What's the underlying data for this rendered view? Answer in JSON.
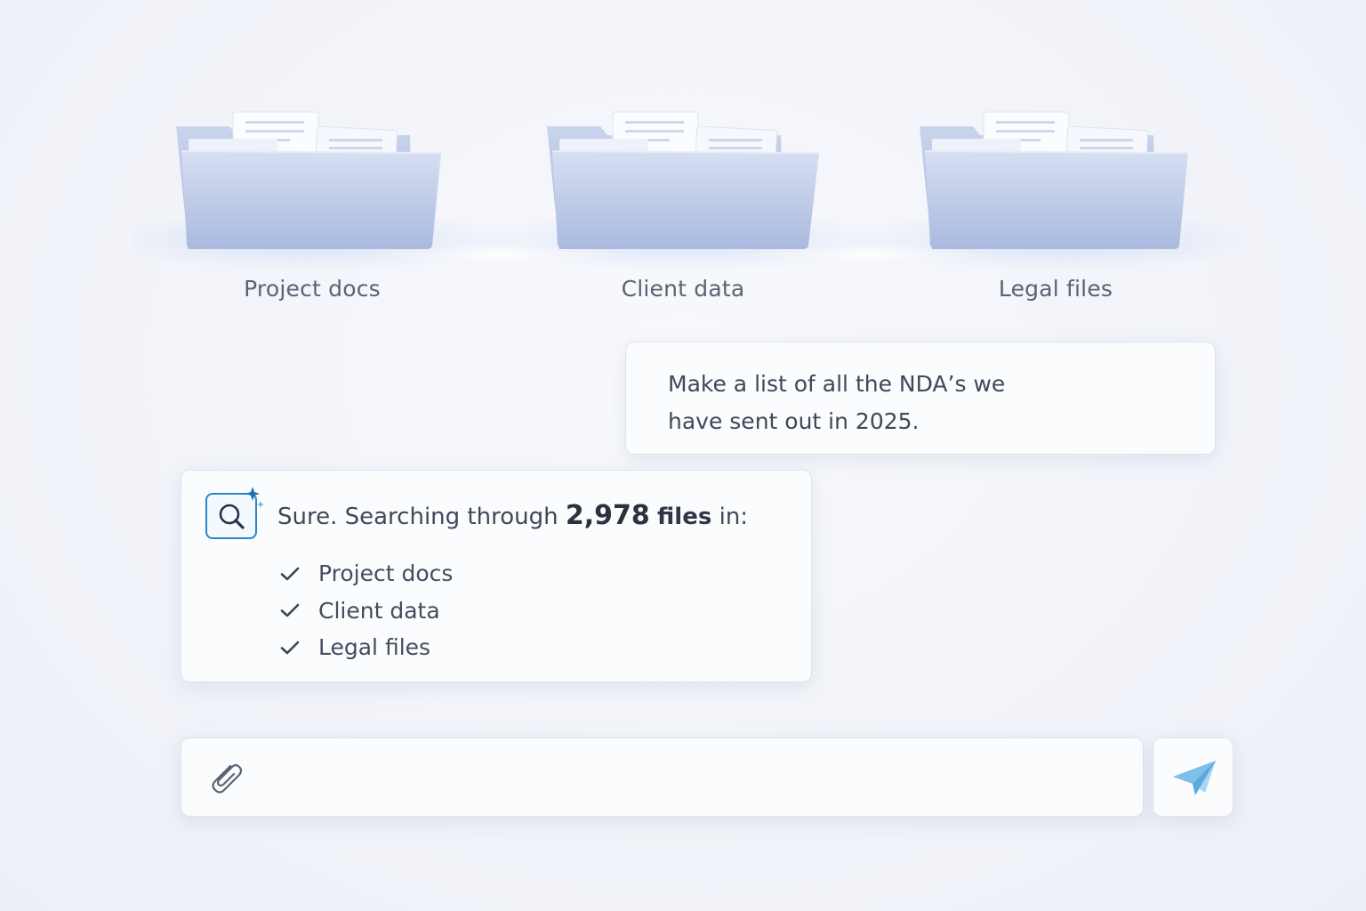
{
  "folders": [
    {
      "label": "Project docs",
      "icon": "folder-icon"
    },
    {
      "label": "Client data",
      "icon": "folder-icon"
    },
    {
      "label": "Legal files",
      "icon": "folder-icon"
    }
  ],
  "chat": {
    "user_message": "Make a list of all the NDA’s we have sent out in 2025.",
    "assistant": {
      "icon": "ai-search-icon",
      "prefix": "Sure. Searching through",
      "count": "2,978",
      "unit": "files",
      "suffix": "in:",
      "checked_sources": [
        "Project docs",
        "Client data",
        "Legal files"
      ]
    }
  },
  "composer": {
    "placeholder": "",
    "attach_icon": "paperclip-icon",
    "send_icon": "paper-plane-icon"
  },
  "colors": {
    "background": "#f1f3f9",
    "folder_blue": "#a9b9dd",
    "accent_blue": "#2b86c5",
    "send_blue": "#8cc8ee"
  }
}
